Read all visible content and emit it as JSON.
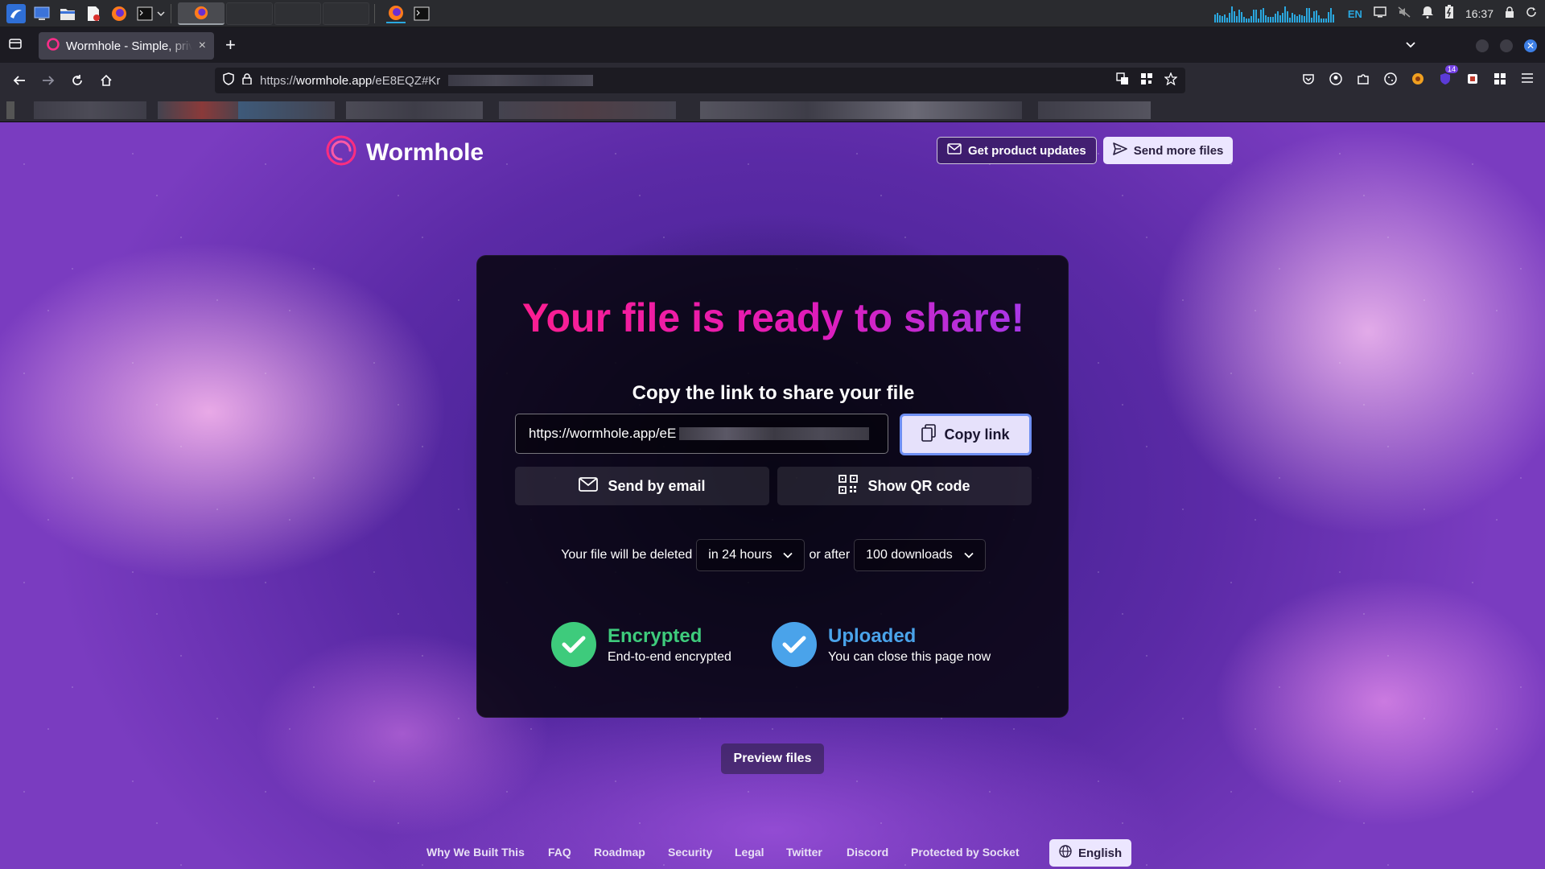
{
  "taskbar": {
    "lang": "EN",
    "clock": "16:37"
  },
  "browser": {
    "tab_title": "Wormhole - Simple, private",
    "tab_close": "×",
    "new_tab": "+",
    "url_prefix": "https://",
    "url_host": "wormhole.app",
    "url_path": "/eE8EQZ#Kr",
    "extension_badge": "14"
  },
  "site": {
    "brand": "Wormhole",
    "updates_button": "Get product updates",
    "send_more_button": "Send more files",
    "headline": "Your file is ready to share!",
    "subhead": "Copy the link to share your file",
    "link_value": "https://wormhole.app/eE",
    "copy_button": "Copy link",
    "email_button": "Send by email",
    "qr_button": "Show QR code",
    "expire_prefix": "Your file will be deleted",
    "expire_time": "in 24 hours",
    "expire_middle": "or after",
    "expire_downloads": "100 downloads",
    "encrypted_title": "Encrypted",
    "encrypted_desc": "End-to-end encrypted",
    "uploaded_title": "Uploaded",
    "uploaded_desc": "You can close this page now",
    "preview_button": "Preview files"
  },
  "footer": {
    "links": [
      "Why We Built This",
      "FAQ",
      "Roadmap",
      "Security",
      "Legal",
      "Twitter",
      "Discord",
      "Protected by Socket"
    ],
    "language": "English"
  },
  "colors": {
    "headline_start": "#ff1f8a",
    "headline_end": "#9b3cf0",
    "encrypted": "#3ecb7c",
    "uploaded": "#4aa3ea",
    "copy_border": "#6f8ff2"
  }
}
